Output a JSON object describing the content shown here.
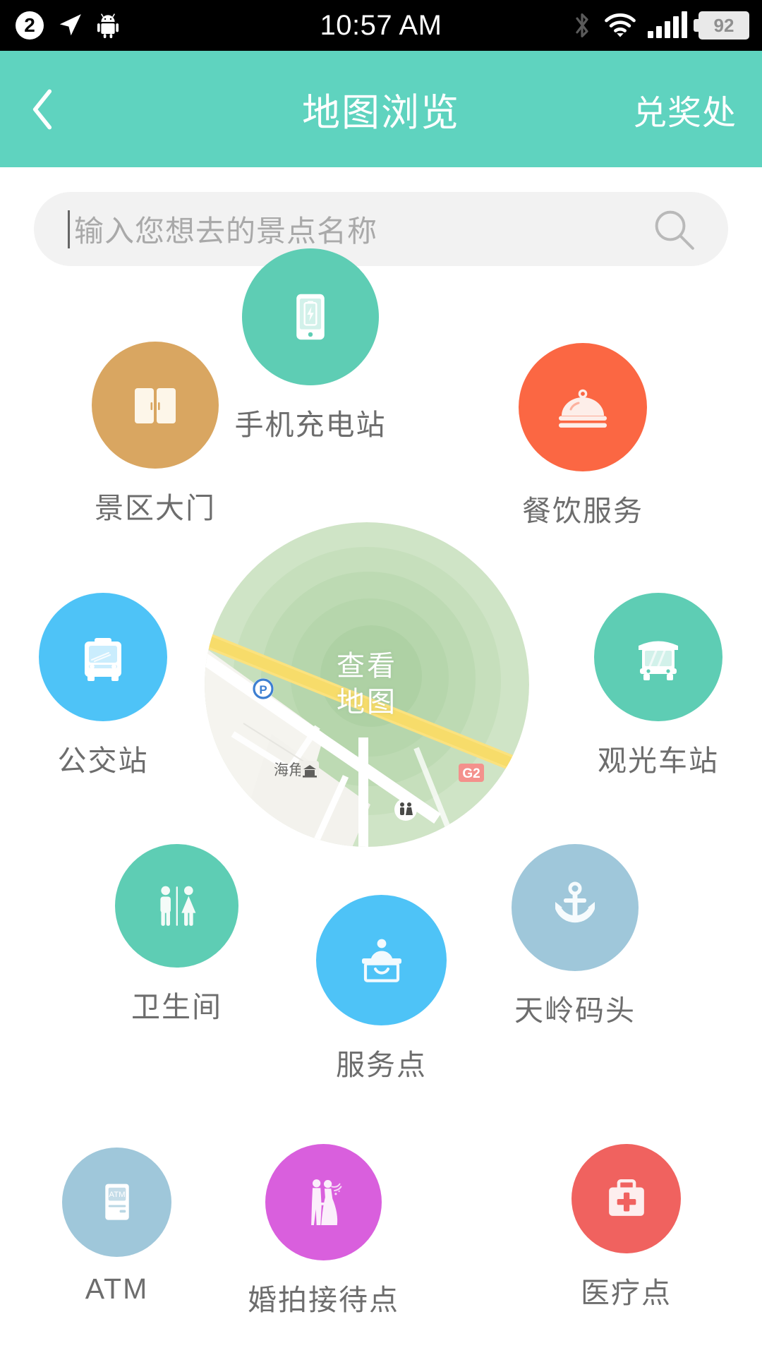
{
  "statusbar": {
    "notification_count": "2",
    "time": "10:57 AM",
    "battery_percent": "92",
    "icons": [
      "notification-badge",
      "location-arrow-icon",
      "android-robot-icon",
      "bluetooth-icon",
      "wifi-icon",
      "signal-bars-icon",
      "battery-icon"
    ]
  },
  "header": {
    "back_label": "chevron-left-icon",
    "title": "地图浏览",
    "action_label": "兑奖处",
    "background_color": "#5fd3bf"
  },
  "search": {
    "value": "",
    "placeholder": "输入您想去的景点名称",
    "icon": "search-icon"
  },
  "map_button": {
    "label_line1": "查看",
    "label_line2": "地图",
    "markers": {
      "parking": "P",
      "place_name": "海角",
      "highway": "G2",
      "temple": "temple-icon",
      "restroom": "restroom-icon"
    }
  },
  "pois": [
    {
      "id": "gate",
      "label": "景区大门",
      "color": "#d9a661",
      "icon": "gate-doors-icon"
    },
    {
      "id": "charging",
      "label": "手机充电站",
      "color": "#5ecdb4",
      "icon": "phone-charging-icon"
    },
    {
      "id": "dining",
      "label": "餐饮服务",
      "color": "#fb6743",
      "icon": "food-cloche-icon"
    },
    {
      "id": "bus",
      "label": "公交站",
      "color": "#4ec3f7",
      "icon": "bus-icon"
    },
    {
      "id": "shuttle",
      "label": "观光车站",
      "color": "#5ecdb4",
      "icon": "shuttle-bus-icon"
    },
    {
      "id": "restroom",
      "label": "卫生间",
      "color": "#5ecdb4",
      "icon": "restroom-icon"
    },
    {
      "id": "service",
      "label": "服务点",
      "color": "#4ec3f7",
      "icon": "info-desk-icon"
    },
    {
      "id": "pier",
      "label": "天岭码头",
      "color": "#9fc7da",
      "icon": "anchor-icon"
    },
    {
      "id": "atm",
      "label": "ATM",
      "color": "#9fc7da",
      "icon": "atm-machine-icon"
    },
    {
      "id": "wedding",
      "label": "婚拍接待点",
      "color": "#d95fdd",
      "icon": "bride-groom-icon"
    },
    {
      "id": "medical",
      "label": "医疗点",
      "color": "#f0625f",
      "icon": "first-aid-kit-icon"
    }
  ]
}
